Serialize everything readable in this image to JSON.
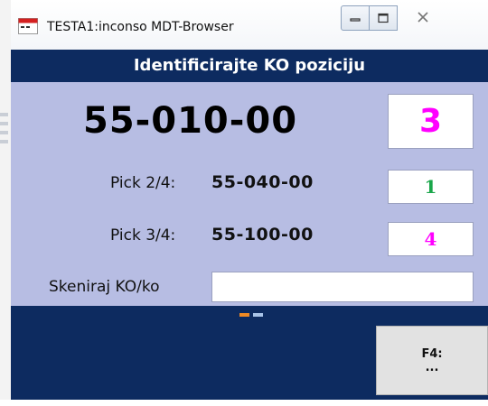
{
  "window": {
    "title": "TESTA1:inconso MDT-Browser"
  },
  "header": {
    "title": "Identificirajte KO poziciju"
  },
  "main": {
    "position": "55-010-00",
    "quantity": "3",
    "quantity_color": "#ff00ff"
  },
  "picks": [
    {
      "label": "Pick 2/4:",
      "position": "55-040-00",
      "quantity": "1",
      "quantity_color": "#1aa64a"
    },
    {
      "label": "Pick 3/4:",
      "position": "55-100-00",
      "quantity": "4",
      "quantity_color": "#ff00ff"
    }
  ],
  "scan": {
    "label": "Skeniraj KO/ko",
    "value": ""
  },
  "pager": {
    "active_color": "#f08a24",
    "inactive_color": "#a9c4e8"
  },
  "function_key": {
    "key": "F4:",
    "label": "..."
  },
  "colors": {
    "header_bg": "#0d2b60",
    "panel_bg": "#b7bde3"
  }
}
